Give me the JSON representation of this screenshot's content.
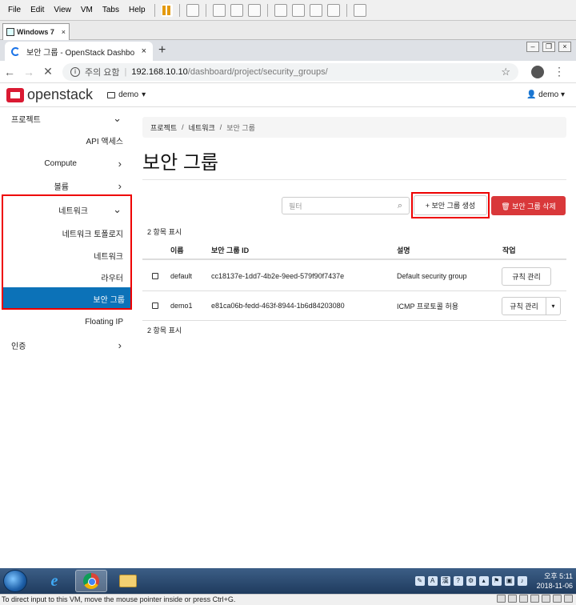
{
  "vm": {
    "menu": [
      "File",
      "Edit",
      "View",
      "VM",
      "Tabs",
      "Help"
    ],
    "tab_title": "Windows 7",
    "status_text": "To direct input to this VM, move the mouse pointer inside or press Ctrl+G."
  },
  "browser": {
    "tab_title": "보안 그룹 - OpenStack Dashbo",
    "security_label": "주의 요함",
    "url_host": "192.168.10.10",
    "url_path": "/dashboard/project/security_groups/"
  },
  "header": {
    "logo": "openstack",
    "project": "demo",
    "user": "demo"
  },
  "sidebar": {
    "items": [
      {
        "label": "프로젝트"
      },
      {
        "label": "API 액세스"
      },
      {
        "label": "Compute"
      },
      {
        "label": "볼륨"
      },
      {
        "label": "네트워크"
      },
      {
        "label": "네트워크 토폴로지"
      },
      {
        "label": "네트워크"
      },
      {
        "label": "라우터"
      },
      {
        "label": "보안 그룹"
      },
      {
        "label": "Floating IP"
      },
      {
        "label": "인증"
      }
    ]
  },
  "breadcrumb": [
    "프로젝트",
    "네트워크",
    "보안 그룹"
  ],
  "page": {
    "title": "보안 그룹",
    "filter_placeholder": "필터",
    "create_button": "+ 보안 그룹 생성",
    "delete_button": "🗑 보안 그룹 삭제",
    "count_top": "2 항목 표시",
    "count_bottom": "2 항목 표시"
  },
  "table": {
    "headers": [
      "이름",
      "보안 그룹 ID",
      "설명",
      "작업"
    ],
    "rows": [
      {
        "name": "default",
        "id": "cc18137e-1dd7-4b2e-9eed-579f90f7437e",
        "desc": "Default security group",
        "action": "규칙 관리"
      },
      {
        "name": "demo1",
        "id": "e81ca06b-fedd-463f-8944-1b6d84203080",
        "desc": "ICMP 프로토콜 허용",
        "action": "규칙 관리"
      }
    ]
  },
  "taskbar": {
    "time": "오후 5:11",
    "date": "2018-11-06",
    "ime": "A",
    "hanja": "漢"
  },
  "colors": {
    "active": "#0c72b8",
    "danger": "#d9383a",
    "highlight": "#ee0000"
  }
}
